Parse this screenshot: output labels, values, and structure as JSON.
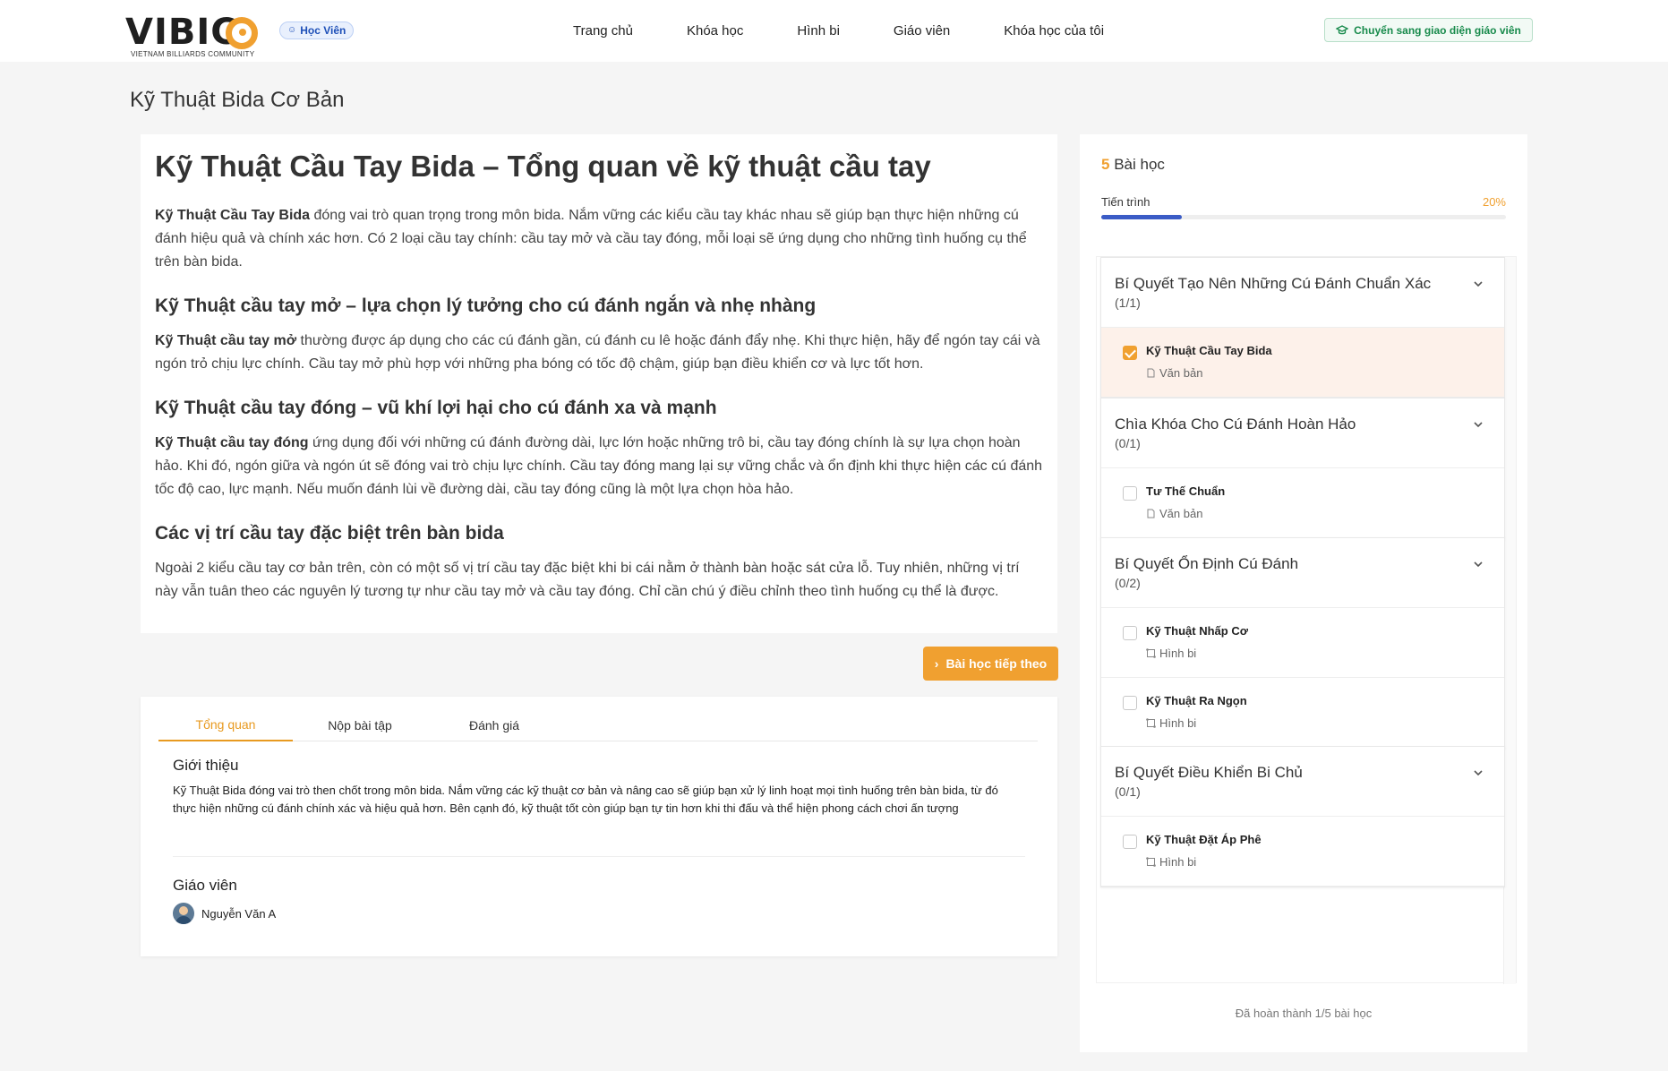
{
  "header": {
    "logo_text": "VIBIC",
    "logo_sub": "VIETNAM BILLIARDS COMMUNITY",
    "role_badge": "Học Viên",
    "nav": [
      "Trang chủ",
      "Khóa học",
      "Hình bi",
      "Giáo viên",
      "Khóa học của tôi"
    ],
    "switch_label": "Chuyển sang giao diện giáo viên"
  },
  "course_title": "Kỹ Thuật Bida Cơ Bản",
  "article": {
    "title": "Kỹ Thuật Cầu Tay Bida – Tổng quan về kỹ thuật cầu tay",
    "p1_bold": "Kỹ Thuật Cầu Tay Bida",
    "p1_text": " đóng vai trò quan trọng trong môn bida. Nắm vững các kiểu cầu tay khác nhau sẽ giúp bạn thực hiện những cú đánh hiệu quả và chính xác hơn. Có 2 loại cầu tay chính: cầu tay mở và cầu tay đóng, mỗi loại sẽ ứng dụng cho những tình huống cụ thể trên bàn bida.",
    "h2_1": "Kỹ Thuật cầu tay mở – lựa chọn lý tưởng cho cú đánh ngắn và nhẹ nhàng",
    "p2_bold": "Kỹ Thuật cầu tay mở",
    "p2_text": " thường được áp dụng cho các cú đánh gần, cú đánh cu lê hoặc đánh đẩy nhẹ. Khi thực hiện, hãy để ngón tay cái và ngón trỏ chịu lực chính. Cầu tay mở phù hợp với những pha bóng có tốc độ chậm, giúp bạn điều khiển cơ và lực tốt hơn.",
    "h2_2": "Kỹ Thuật cầu tay đóng – vũ khí lợi hại cho cú đánh xa và mạnh",
    "p3_bold": "Kỹ Thuật cầu tay đóng",
    "p3_text": " ứng dụng đối với những cú đánh đường dài, lực lớn hoặc những trô bi, cầu tay đóng chính là sự lựa chọn hoàn hảo. Khi đó, ngón giữa và ngón út sẽ đóng vai trò chịu lực chính. Cầu tay đóng mang lại sự vững chắc và ổn định khi thực hiện các cú đánh tốc độ cao, lực mạnh. Nếu muốn đánh lùi về đường dài, cầu tay đóng cũng là một lựa chọn hòa hảo.",
    "h2_3": "Các vị trí cầu tay đặc biệt trên bàn bida",
    "p4_text": "Ngoài 2 kiểu cầu tay cơ bản trên, còn có một số vị trí cầu tay đặc biệt khi bi cái nằm ở thành bàn hoặc sát cửa lỗ. Tuy nhiên, những vị trí này vẫn tuân theo các nguyên lý tương tự như cầu tay mở và cầu tay đóng. Chỉ cần chú ý điều chỉnh theo tình huống cụ thể là được."
  },
  "next_button": "Bài học tiếp theo",
  "tabs": [
    "Tổng quan",
    "Nộp bài tập",
    "Đánh giá"
  ],
  "overview": {
    "intro_title": "Giới thiệu",
    "intro_text": "Kỹ Thuật Bida đóng vai trò then chốt trong môn bida. Nắm vững các kỹ thuật cơ bản và nâng cao sẽ giúp bạn xử lý linh hoạt mọi tình huống trên bàn bida, từ đó thực hiện những cú đánh chính xác và hiệu quả hơn. Bên cạnh đó, kỹ thuật tốt còn giúp bạn tự tin hơn khi thi đấu và thể hiện phong cách chơi ấn tượng",
    "teacher_title": "Giáo viên",
    "teacher_name": "Nguyễn Văn A"
  },
  "sidebar": {
    "lesson_count": "5",
    "lesson_count_label": " Bài học",
    "progress_label": "Tiến trình",
    "progress_pct": "20%",
    "progress_value": 0.2,
    "footer": "Đã hoàn thành 1/5 bài học",
    "sections": [
      {
        "name": "Bí Quyết Tạo Nên Những Cú Đánh Chuẩn Xác",
        "count": "(1/1)",
        "lessons": [
          {
            "name": "Kỹ Thuật Cầu Tay Bida",
            "type": "Văn bản",
            "checked": true,
            "active": true
          }
        ]
      },
      {
        "name": "Chìa Khóa Cho Cú Đánh Hoàn Hảo",
        "count": "(0/1)",
        "lessons": [
          {
            "name": "Tư Thế Chuẩn",
            "type": "Văn bản",
            "checked": false
          }
        ]
      },
      {
        "name": "Bí Quyết Ổn Định Cú Đánh",
        "count": "(0/2)",
        "lessons": [
          {
            "name": "Kỹ Thuật Nhấp Cơ",
            "type": "Hình bi",
            "checked": false
          },
          {
            "name": "Kỹ Thuật Ra Ngọn",
            "type": "Hình bi",
            "checked": false
          }
        ]
      },
      {
        "name": "Bí Quyết Điều Khiển Bi Chủ",
        "count": "(0/1)",
        "lessons": [
          {
            "name": "Kỹ Thuật Đặt Áp Phê",
            "type": "Hình bi",
            "checked": false
          }
        ]
      }
    ]
  },
  "colors": {
    "accent": "#f0a030",
    "progress": "#3b5cc6",
    "switch": "#178a4b",
    "badge": "#1d4fb8"
  }
}
